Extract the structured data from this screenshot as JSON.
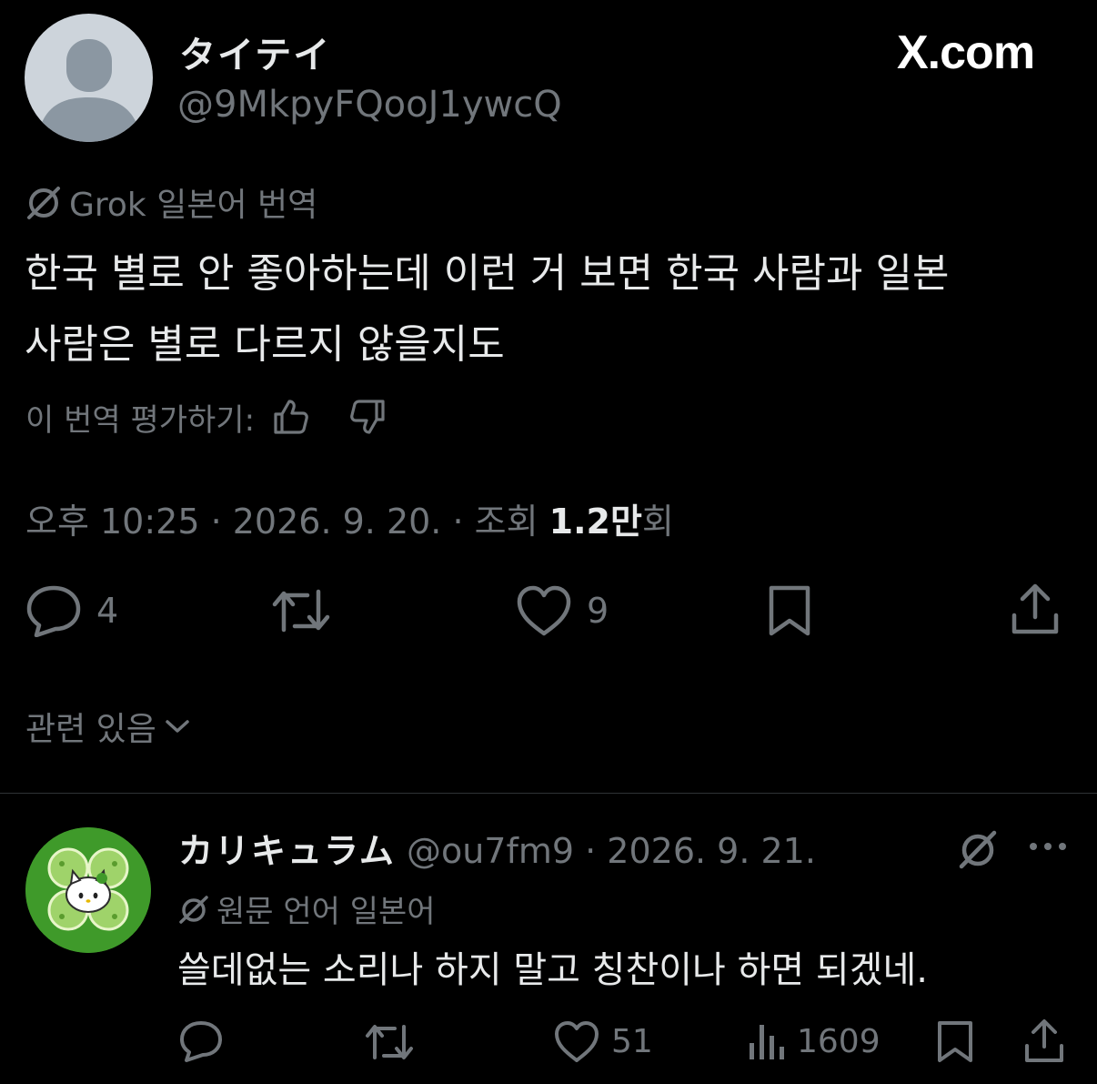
{
  "header": {
    "display_name": "タイテイ",
    "handle": "@9MkpyFQooJ1ywcQ",
    "brand": "X.com"
  },
  "translation": {
    "label": "Grok 일본어 번역"
  },
  "tweet": {
    "text_line1": "한국 별로 안 좋아하는데 이런 거 보면 한국 사람과 일본",
    "text_line2": "사람은 별로 다르지 않을지도",
    "rate_label": "이 번역 평가하기:",
    "time": "오후 10:25 · 2026. 9. 20. · 조회 ",
    "views_value": "1.2만",
    "views_suffix": "회"
  },
  "actions": {
    "replies": "4",
    "likes": "9"
  },
  "related": {
    "label": "관련 있음"
  },
  "reply": {
    "display_name": "カリキュラム",
    "handle_date": "@ou7fm9 · 2026. 9. 21.",
    "lang_label": "원문 언어 일본어",
    "text": "쓸데없는 소리나 하지 말고 칭찬이나 하면 되겠네.",
    "likes": "51",
    "views": "1609"
  },
  "colors": {
    "background": "#000000",
    "text_primary": "#e7e9ea",
    "text_secondary": "#71767b",
    "divider": "#2f3336",
    "reply_avatar": "#3f9a2a"
  }
}
